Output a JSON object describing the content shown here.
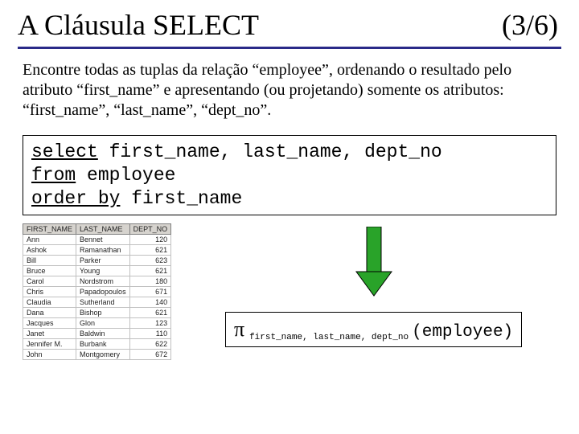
{
  "header": {
    "title": "A Cláusula SELECT",
    "pager": "(3/6)"
  },
  "description": "Encontre todas as tuplas da relação “employee”, ordenando o resultado pelo atributo “first_name” e apresentando (ou projetando) somente os atributos: “first_name”, “last_name”, “dept_no”.",
  "sql": {
    "select_kw": "select",
    "select_cols": " first_name, last_name, dept_no",
    "from_kw": "from",
    "from_rel": " employee",
    "orderby_kw": "order by",
    "orderby_col": " first_name"
  },
  "table": {
    "headers": [
      "FIRST_NAME",
      "LAST_NAME",
      "DEPT_NO"
    ],
    "rows": [
      [
        "Ann",
        "Bennet",
        "120"
      ],
      [
        "Ashok",
        "Ramanathan",
        "621"
      ],
      [
        "Bill",
        "Parker",
        "623"
      ],
      [
        "Bruce",
        "Young",
        "621"
      ],
      [
        "Carol",
        "Nordstrom",
        "180"
      ],
      [
        "Chris",
        "Papadopoulos",
        "671"
      ],
      [
        "Claudia",
        "Sutherland",
        "140"
      ],
      [
        "Dana",
        "Bishop",
        "621"
      ],
      [
        "Jacques",
        "Glon",
        "123"
      ],
      [
        "Janet",
        "Baldwin",
        "110"
      ],
      [
        "Jennifer M.",
        "Burbank",
        "622"
      ],
      [
        "John",
        "Montgomery",
        "672"
      ]
    ]
  },
  "ra": {
    "pi": "π",
    "subscript": "first_name, last_name, dept_no",
    "relation": "(employee)"
  }
}
